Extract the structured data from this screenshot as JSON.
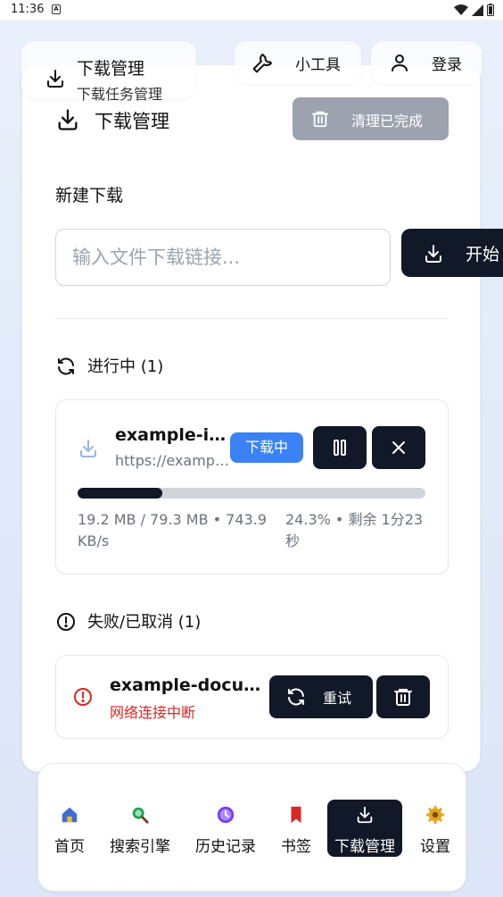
{
  "status_bar": {
    "time": "11:36",
    "sim_badge": "A"
  },
  "header": {
    "title": "下载管理",
    "subtitle": "下载任务管理",
    "tools_label": "小工具",
    "login_label": "登录"
  },
  "page": {
    "title": "下载管理",
    "clear_completed_label": "清理已完成"
  },
  "new_download": {
    "section_label": "新建下载",
    "input_placeholder": "输入文件下载链接...",
    "input_value": "",
    "start_label": "开始"
  },
  "active": {
    "section_label": "进行中 (1)",
    "items": [
      {
        "file_name": "example-image.jpg",
        "url": "https://example.com/image.jpg",
        "status": "下载中",
        "progress_percent": 24.3,
        "size_speed": "19.2 MB / 79.3 MB • 743.9 KB/s",
        "percent_remaining": "24.3% • 剩余 1分23秒"
      }
    ]
  },
  "failed": {
    "section_label": "失败/已取消 (1)",
    "items": [
      {
        "file_name": "example-document.pdf",
        "error": "网络连接中断",
        "retry_label": "重试"
      }
    ]
  },
  "bottom_nav": {
    "items": [
      {
        "label": "首页",
        "icon": "home-icon"
      },
      {
        "label": "搜索引擎",
        "icon": "search-icon"
      },
      {
        "label": "历史记录",
        "icon": "history-icon"
      },
      {
        "label": "书签",
        "icon": "bookmark-icon"
      },
      {
        "label": "下载管理",
        "icon": "download-icon",
        "active": true
      },
      {
        "label": "设置",
        "icon": "settings-icon"
      }
    ]
  },
  "colors": {
    "primary_dark": "#111827",
    "accent_blue": "#3b82f6",
    "error_red": "#dc2626",
    "muted_gray": "#9ca3af"
  }
}
